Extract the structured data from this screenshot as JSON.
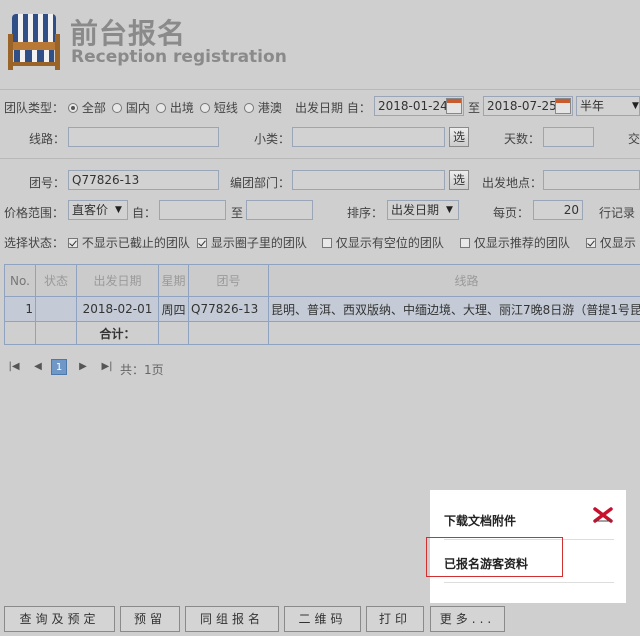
{
  "header": {
    "title_cn": "前台报名",
    "title_en": "Reception registration"
  },
  "filters": {
    "team_type_label": "团队类型：",
    "team_type_options": [
      "全部",
      "国内",
      "出境",
      "短线",
      "港澳"
    ],
    "team_type_selected": "全部",
    "depart_date_label": "出发日期 自：",
    "date_from": "2018-01-24",
    "date_to_label": "至",
    "date_to": "2018-07-25",
    "period_value": "半年",
    "route_label": "线路：",
    "route_value": "",
    "subcat_label": "小类：",
    "subcat_value": "",
    "select_btn": "选",
    "days_label": "天数：",
    "days_value": "",
    "traffic_label_cut": "交",
    "team_no_label": "团号：",
    "team_no_value": "Q77826-13",
    "dept_label": "编团部门：",
    "dept_value": "",
    "depart_place_label": "出发地点：",
    "depart_place_value": "",
    "price_range_label": "价格范围：",
    "price_type": "直客价",
    "price_from_label": "自：",
    "price_from": "",
    "price_to_label": "至",
    "price_to": "",
    "sort_label": "排序：",
    "sort_value": "出发日期",
    "per_page_label": "每页：",
    "per_page_value": "20",
    "per_page_unit": "行记录",
    "status_label": "选择状态：",
    "status_options": [
      {
        "label": "不显示已截止的团队",
        "checked": true
      },
      {
        "label": "显示圈子里的团队",
        "checked": true
      },
      {
        "label": "仅显示有空位的团队",
        "checked": false
      },
      {
        "label": "仅显示推荐的团队",
        "checked": false
      },
      {
        "label": "仅显示",
        "checked": true
      }
    ]
  },
  "table": {
    "headers": [
      "No.",
      "状态",
      "出发日期",
      "星期",
      "团号",
      "线路"
    ],
    "rows": [
      {
        "no": "1",
        "status": "",
        "date": "2018-02-01",
        "weekday": "周四",
        "team_no": "Q77826-13",
        "route": "昆明、普洱、西双版纳、中缅边境、大理、丽江7晚8日游（普提1号昆"
      }
    ],
    "total_label": "合计："
  },
  "pager": {
    "current_page": "1",
    "total_text": "共：1页"
  },
  "popup": {
    "item1": "下载文档附件",
    "item2": "已报名游客资料"
  },
  "buttons": [
    "查询及预定",
    "预留",
    "同组报名",
    "二维码",
    "打印",
    "更多..."
  ],
  "colors": {
    "background": "#cfcfcf",
    "page_current": "#6f98c8",
    "highlight_border": "#d23030",
    "close_icon": "#c8102e"
  }
}
